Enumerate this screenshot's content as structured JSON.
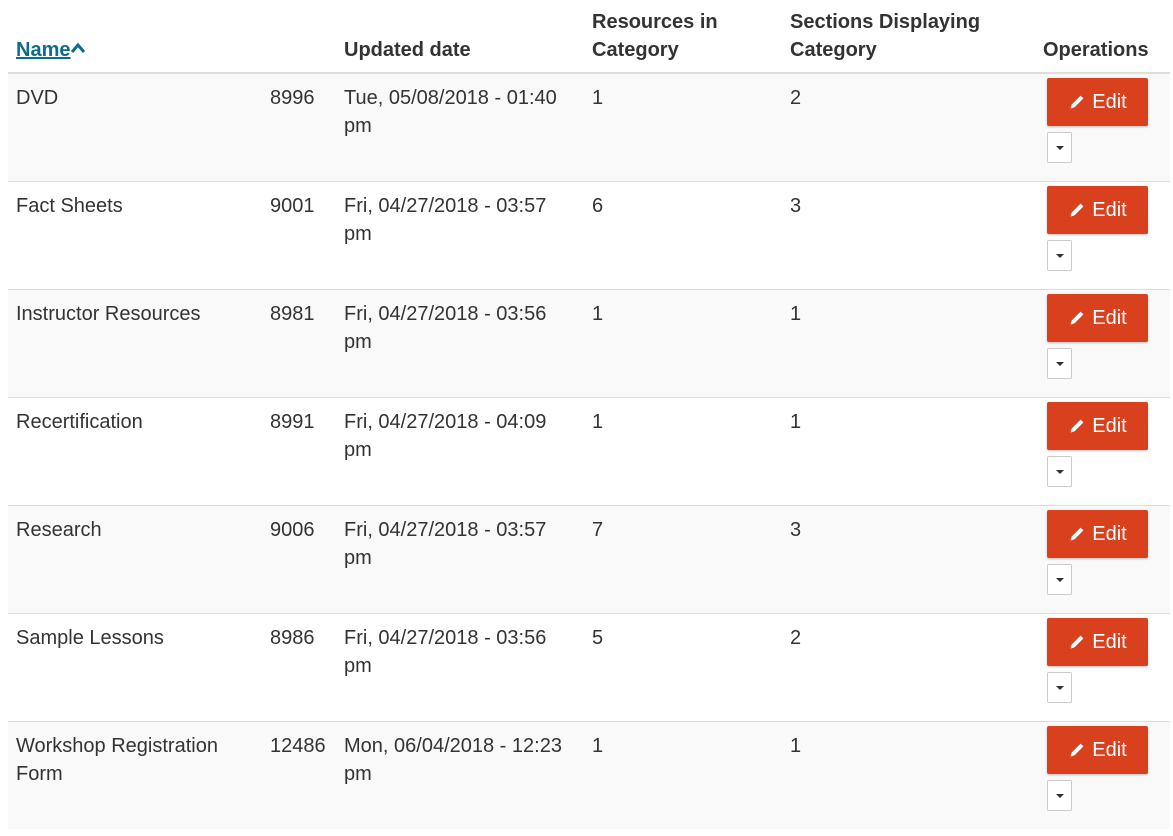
{
  "columns": {
    "name": "Name",
    "id": "",
    "updated": "Updated date",
    "resources": "Resources in Category",
    "sections": "Sections Displaying Category",
    "operations": "Operations"
  },
  "sort": {
    "column": "name",
    "direction": "ascending",
    "icon": "chevron-up-icon"
  },
  "edit_label": "Edit",
  "accent_color": "#d9411e",
  "link_color": "#0a6e8a",
  "rows": [
    {
      "name": "DVD",
      "id": "8996",
      "updated": "Tue, 05/08/2018 - 01:40 pm",
      "resources": "1",
      "sections": "2"
    },
    {
      "name": "Fact Sheets",
      "id": "9001",
      "updated": "Fri, 04/27/2018 - 03:57 pm",
      "resources": "6",
      "sections": "3"
    },
    {
      "name": "Instructor Resources",
      "id": "8981",
      "updated": "Fri, 04/27/2018 - 03:56 pm",
      "resources": "1",
      "sections": "1"
    },
    {
      "name": "Recertification",
      "id": "8991",
      "updated": "Fri, 04/27/2018 - 04:09 pm",
      "resources": "1",
      "sections": "1"
    },
    {
      "name": "Research",
      "id": "9006",
      "updated": "Fri, 04/27/2018 - 03:57 pm",
      "resources": "7",
      "sections": "3"
    },
    {
      "name": "Sample Lessons",
      "id": "8986",
      "updated": "Fri, 04/27/2018 - 03:56 pm",
      "resources": "5",
      "sections": "2"
    },
    {
      "name": "Workshop Registration Form",
      "id": "12486",
      "updated": "Mon, 06/04/2018 - 12:23 pm",
      "resources": "1",
      "sections": "1"
    }
  ]
}
